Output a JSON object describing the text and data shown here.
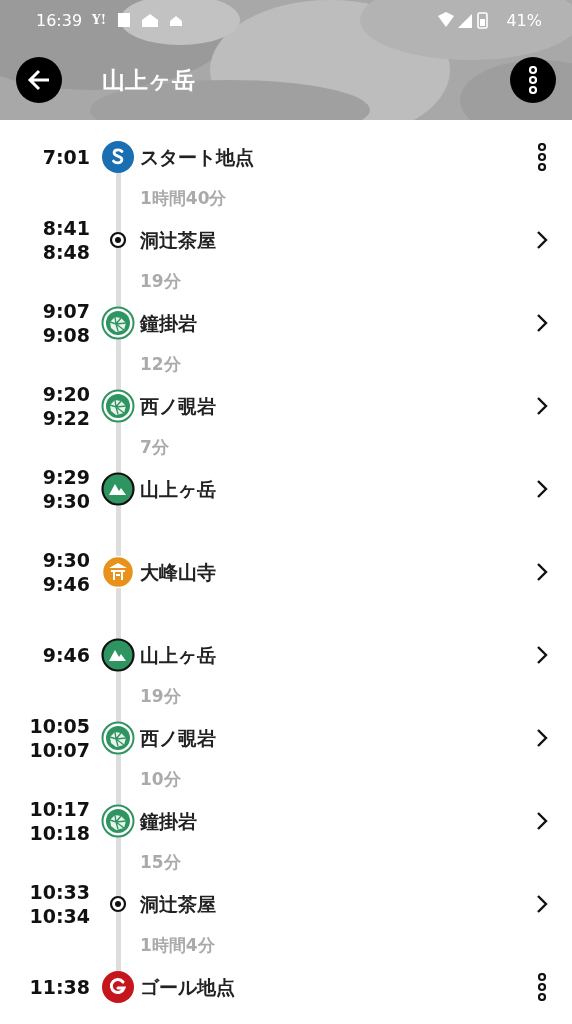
{
  "status_bar": {
    "time": "16:39",
    "notification_text": "Y!",
    "battery": "41%"
  },
  "header": {
    "title": "山上ヶ岳"
  },
  "stops": [
    {
      "kind": "start",
      "times": [
        "7:01"
      ],
      "name": "スタート地点",
      "menu": true,
      "duration": "1時間40分"
    },
    {
      "kind": "waypoint",
      "times": [
        "8:41",
        "8:48"
      ],
      "name": "洞辻茶屋",
      "menu": false,
      "duration": "19分"
    },
    {
      "kind": "rock",
      "times": [
        "9:07",
        "9:08"
      ],
      "name": "鐘掛岩",
      "menu": false,
      "duration": "12分"
    },
    {
      "kind": "rock",
      "times": [
        "9:20",
        "9:22"
      ],
      "name": "西ノ覗岩",
      "menu": false,
      "duration": "7分"
    },
    {
      "kind": "peak",
      "times": [
        "9:29",
        "9:30"
      ],
      "name": "山上ヶ岳",
      "menu": false
    },
    {
      "kind": "temple",
      "times": [
        "9:30",
        "9:46"
      ],
      "name": "大峰山寺",
      "menu": false
    },
    {
      "kind": "peak",
      "times": [
        "9:46"
      ],
      "name": "山上ヶ岳",
      "menu": false,
      "duration": "19分"
    },
    {
      "kind": "rock",
      "times": [
        "10:05",
        "10:07"
      ],
      "name": "西ノ覗岩",
      "menu": false,
      "duration": "10分"
    },
    {
      "kind": "rock",
      "times": [
        "10:17",
        "10:18"
      ],
      "name": "鐘掛岩",
      "menu": false,
      "duration": "15分"
    },
    {
      "kind": "waypoint",
      "times": [
        "10:33",
        "10:34"
      ],
      "name": "洞辻茶屋",
      "menu": false,
      "duration": "1時間4分"
    },
    {
      "kind": "goal",
      "times": [
        "11:38"
      ],
      "name": "ゴール地点",
      "menu": true
    }
  ]
}
